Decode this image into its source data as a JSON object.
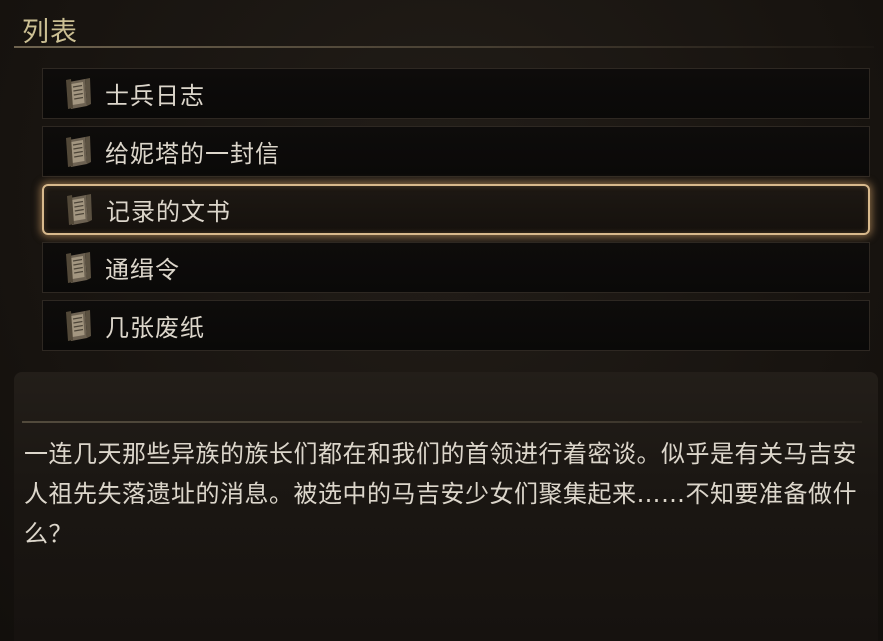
{
  "section": {
    "title": "列表"
  },
  "items": [
    {
      "label": "士兵日志",
      "icon": "document-scroll-icon",
      "selected": false
    },
    {
      "label": "给妮塔的一封信",
      "icon": "document-scroll-icon",
      "selected": false
    },
    {
      "label": "记录的文书",
      "icon": "document-scroll-icon",
      "selected": true
    },
    {
      "label": "通缉令",
      "icon": "document-scroll-icon",
      "selected": false
    },
    {
      "label": "几张废纸",
      "icon": "document-scroll-icon",
      "selected": false
    }
  ],
  "description": {
    "text": "一连几天那些异族的族长们都在和我们的首领进行着密谈。似乎是有关马吉安人祖先失落遗址的消息。被选中的马吉安少女们聚集起来……不知要准备做什么？"
  },
  "colors": {
    "title": "#cbbf93",
    "text": "#dcd6cb",
    "selected_border": "#d8b98c",
    "background": "#181512"
  }
}
